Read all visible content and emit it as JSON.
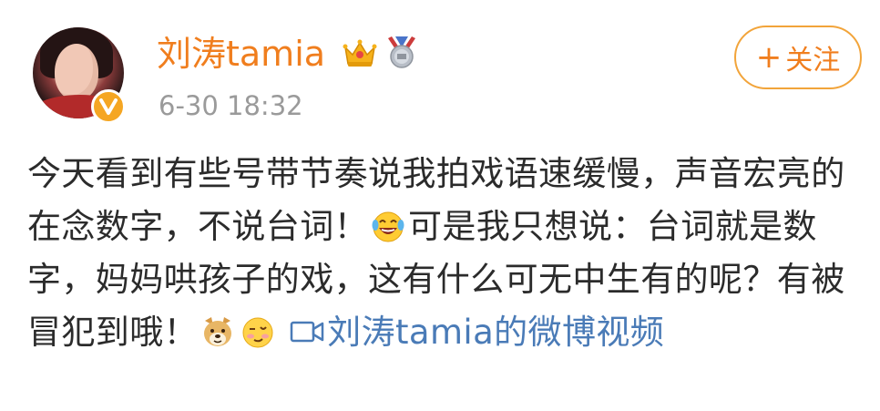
{
  "post": {
    "username": "刘涛tamia",
    "timestamp": "6-30 18:32",
    "follow_label": "关注",
    "follow_plus": "+",
    "text_part1": "今天看到有些号带节奏说我拍戏语速缓慢，声音宏亮的在念数字，不说台词！",
    "text_part2": "可是我只想说：台词就是数字，妈妈哄孩子的戏，这有什么可无中生有的呢？有被冒犯到哦！",
    "video_link": "刘涛tamia的微博视频"
  },
  "icons": {
    "verified_badge": "verified-v-icon",
    "crown": "vip-crown-icon",
    "medal": "medal-icon",
    "laugh_emoji": "laugh-cry-emoji",
    "doge_emoji": "doge-emoji",
    "wink_emoji": "wink-emoji",
    "video": "video-camera-icon"
  },
  "colors": {
    "username": "#f07e1e",
    "follow_border": "#f2a43a",
    "timestamp": "#9a9a9a",
    "body_text": "#2b2b2b",
    "link": "#4a7bb7",
    "verified": "#f5a623"
  }
}
